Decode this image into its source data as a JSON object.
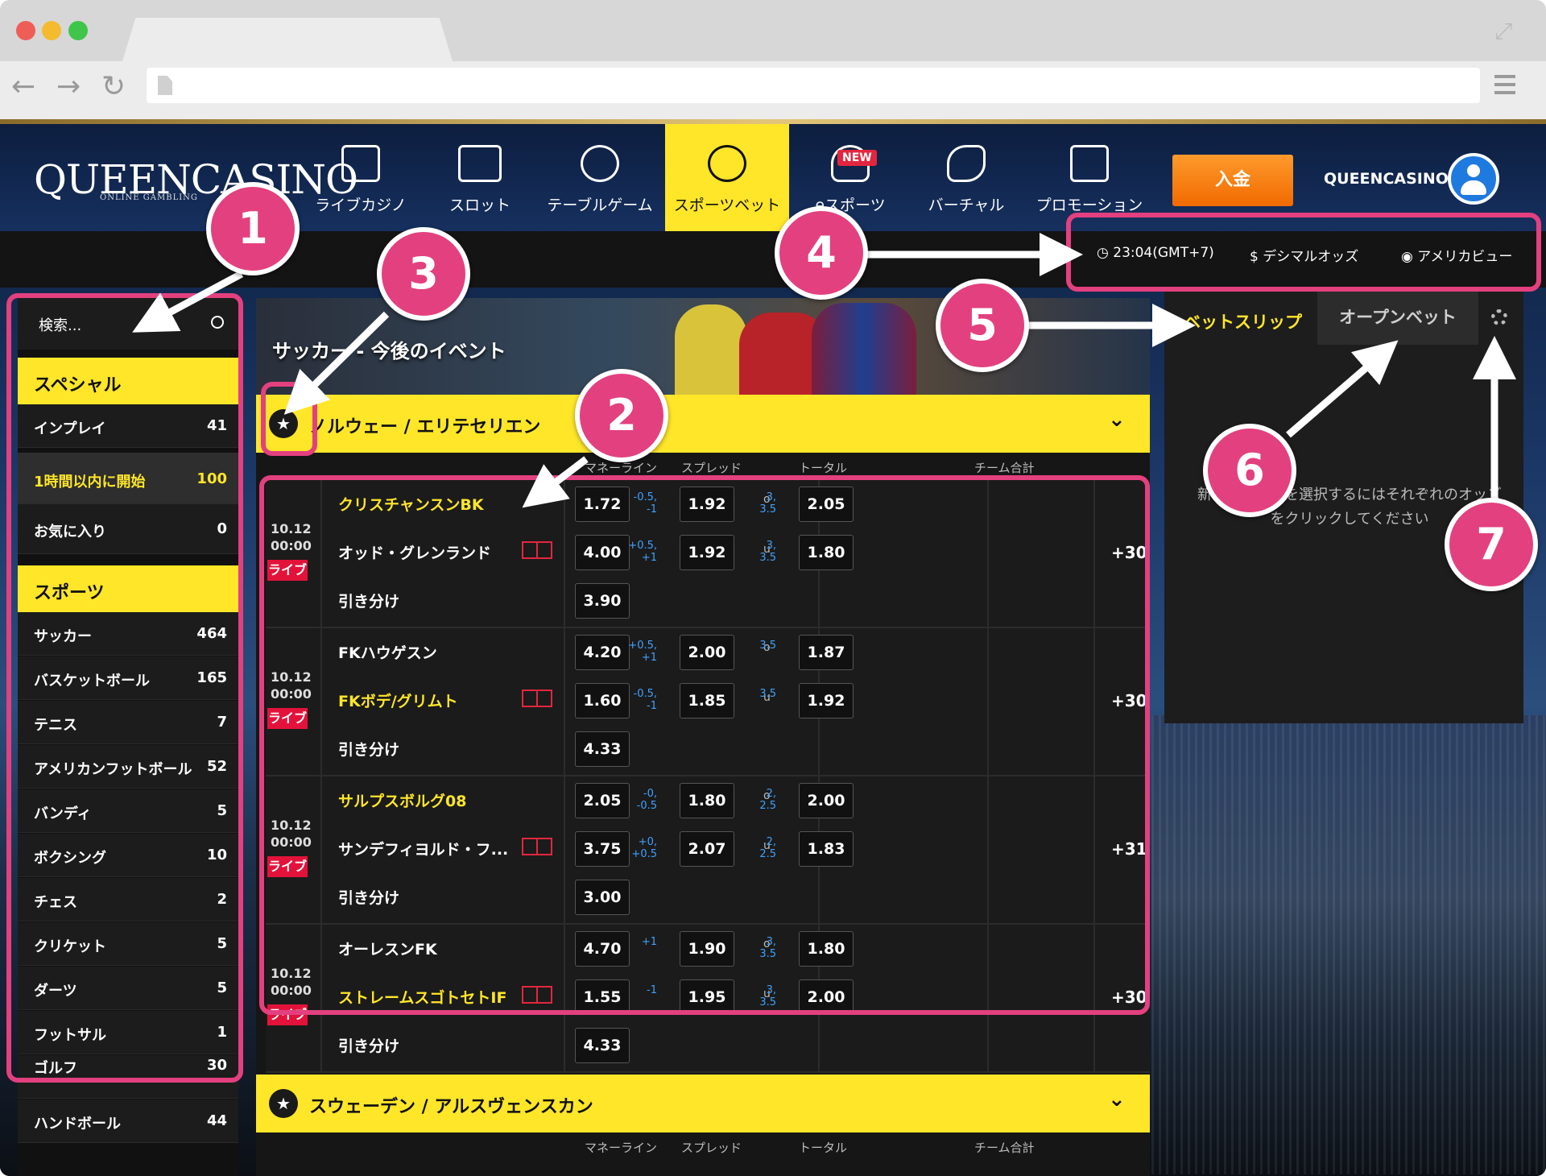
{
  "header": {
    "logo": "QUEENCASINO",
    "logo_sub": "ONLINE GAMBLING",
    "nav": [
      {
        "label": "ライブカジノ",
        "icon": "live-casino-icon"
      },
      {
        "label": "スロット",
        "icon": "slot-icon"
      },
      {
        "label": "テーブルゲーム",
        "icon": "roulette-icon"
      },
      {
        "label": "スポーツベット",
        "icon": "sports-ball-icon",
        "active": true
      },
      {
        "label": "eスポーツ",
        "icon": "esports-icon",
        "badge": "NEW"
      },
      {
        "label": "バーチャル",
        "icon": "horse-icon"
      },
      {
        "label": "プロモーション",
        "icon": "gift-icon"
      }
    ],
    "deposit": "入金",
    "username": "QUEENCASINO"
  },
  "utilities": {
    "time": "23:04(GMT+7)",
    "odds_format": "デシマルオッズ",
    "view": "アメリカビュー"
  },
  "sidebar": {
    "search_placeholder": "検索...",
    "special_title": "スペシャル",
    "special": [
      {
        "name": "インプレイ",
        "count": "41"
      },
      {
        "name": "1時間以内に開始",
        "count": "100"
      },
      {
        "name": "お気に入り",
        "count": "0"
      }
    ],
    "sports_title": "スポーツ",
    "sports": [
      {
        "name": "サッカー",
        "count": "464"
      },
      {
        "name": "バスケットボール",
        "count": "165"
      },
      {
        "name": "テニス",
        "count": "7"
      },
      {
        "name": "アメリカンフットボール",
        "count": "52"
      },
      {
        "name": "バンディ",
        "count": "5"
      },
      {
        "name": "ボクシング",
        "count": "10"
      },
      {
        "name": "チェス",
        "count": "2"
      },
      {
        "name": "クリケット",
        "count": "5"
      },
      {
        "name": "ダーツ",
        "count": "5"
      },
      {
        "name": "フットサル",
        "count": "1"
      },
      {
        "name": "ゴルフ",
        "count": "30"
      },
      {
        "name": "ハンドボール",
        "count": "44"
      }
    ]
  },
  "main": {
    "banner_title": "サッカー - 今後のイベント",
    "columns": [
      "マネーライン",
      "スプレッド",
      "トータル",
      "チーム合計"
    ],
    "leagues": [
      {
        "name": "ノルウェー / エリテセリエン"
      },
      {
        "name": "スウェーデン / アルスヴェンスカン"
      }
    ],
    "matches": [
      {
        "date": "10.12",
        "time": "00:00",
        "live": "ライブ",
        "home": "クリスチャンスンBK",
        "away": "オッド・グレンランド",
        "draw": "引き分け",
        "ml": [
          "1.72",
          "4.00",
          "3.90"
        ],
        "sp_h": "-0.5,\n-1",
        "sp_h_odd": "1.92",
        "sp_a": "+0.5,\n+1",
        "sp_a_odd": "1.92",
        "t_o": "o",
        "t_ol": "3,\n3.5",
        "t_o_odd": "2.05",
        "t_u": "u",
        "t_ul": "3,\n3.5",
        "t_u_odd": "1.80",
        "more": "+30"
      },
      {
        "date": "10.12",
        "time": "00:00",
        "live": "ライブ",
        "home": "FKハウゲスン",
        "away": "FKボデ/グリムト",
        "draw": "引き分け",
        "ml": [
          "4.20",
          "1.60",
          "4.33"
        ],
        "sp_h": "+0.5,\n+1",
        "sp_h_odd": "2.00",
        "sp_a": "-0.5,\n-1",
        "sp_a_odd": "1.85",
        "t_o": "o",
        "t_ol": "3.5",
        "t_o_odd": "1.87",
        "t_u": "u",
        "t_ul": "3.5",
        "t_u_odd": "1.92",
        "more": "+30"
      },
      {
        "date": "10.12",
        "time": "00:00",
        "live": "ライブ",
        "home": "サルプスボルグ08",
        "away": "サンデフィヨルド・フ...",
        "draw": "引き分け",
        "ml": [
          "2.05",
          "3.75",
          "3.00"
        ],
        "sp_h": "-0,\n-0.5",
        "sp_h_odd": "1.80",
        "sp_a": "+0,\n+0.5",
        "sp_a_odd": "2.07",
        "t_o": "o",
        "t_ol": "2,\n2.5",
        "t_o_odd": "2.00",
        "t_u": "u",
        "t_ul": "2,\n2.5",
        "t_u_odd": "1.83",
        "more": "+31"
      },
      {
        "date": "10.12",
        "time": "00:00",
        "live": "ライブ",
        "home": "オーレスンFK",
        "away": "ストレームスゴトセトIF",
        "draw": "引き分け",
        "ml": [
          "4.70",
          "1.55",
          "4.33"
        ],
        "sp_h": "+1",
        "sp_h_odd": "1.90",
        "sp_a": "-1",
        "sp_a_odd": "1.95",
        "t_o": "o",
        "t_ol": "3,\n3.5",
        "t_o_odd": "1.80",
        "t_u": "u",
        "t_ul": "3,\n3.5",
        "t_u_odd": "2.00",
        "more": "+30"
      }
    ]
  },
  "betslip": {
    "tab_betslip": "ベットスリップ",
    "tab_open": "オープンベット",
    "message": "新しいベットを選択するにはそれぞれのオッズをクリックしてください"
  },
  "annotations": [
    "1",
    "2",
    "3",
    "4",
    "5",
    "6",
    "7"
  ],
  "colors": {
    "accent": "#ffe629",
    "annotation": "#e3407f",
    "live": "#e3123a",
    "deposit": "#f48417",
    "nav_bg": "#0d1e3f"
  }
}
